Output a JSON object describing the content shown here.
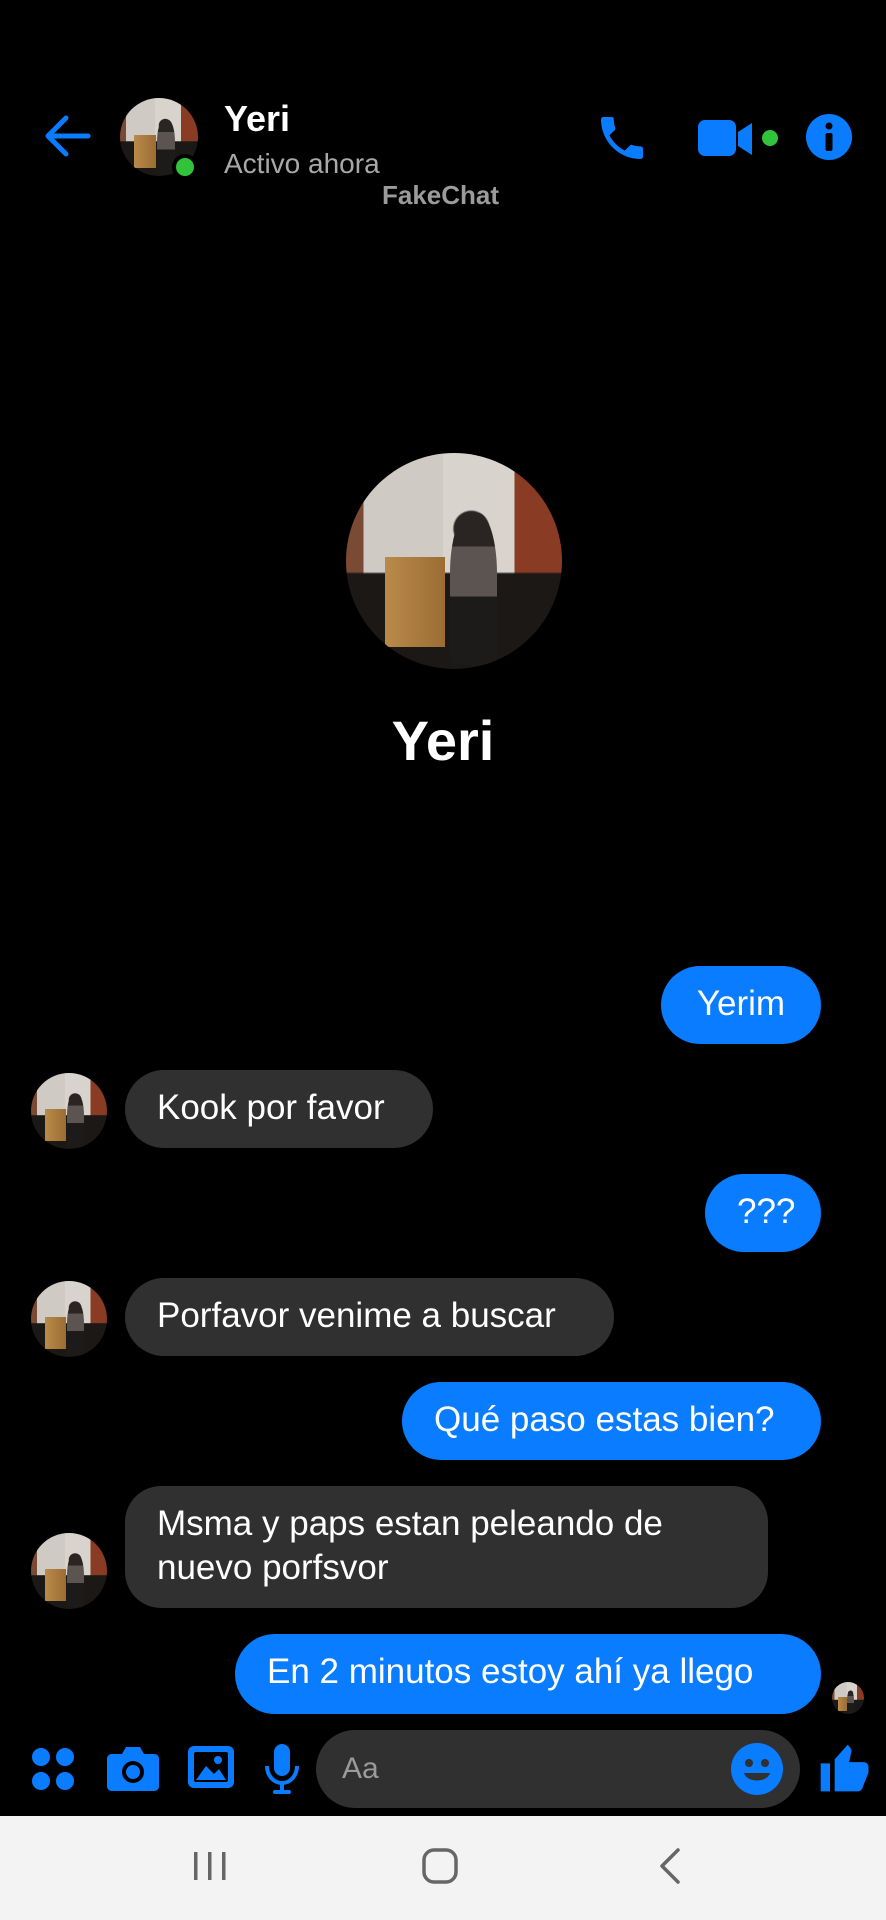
{
  "header": {
    "contact_name": "Yeri",
    "status": "Activo ahora",
    "watermark": "FakeChat"
  },
  "profile": {
    "name": "Yeri"
  },
  "messages": [
    {
      "direction": "outgoing",
      "text": "Yerim"
    },
    {
      "direction": "incoming",
      "text": "Kook por favor"
    },
    {
      "direction": "outgoing",
      "text": "???"
    },
    {
      "direction": "incoming",
      "text": "Porfavor venime a buscar"
    },
    {
      "direction": "outgoing",
      "text": "Qué paso estas bien?"
    },
    {
      "direction": "incoming",
      "lines": [
        "Msma y paps estan peleando de",
        "nuevo porfsvor"
      ]
    },
    {
      "direction": "outgoing",
      "text": "En 2 minutos estoy ahí ya llego"
    }
  ],
  "composer": {
    "placeholder": "Aa"
  },
  "colors": {
    "accent": "#0a7cff",
    "incoming_bubble": "#303030",
    "online": "#31c43b",
    "background": "#000000"
  },
  "icons": [
    "back-arrow-icon",
    "phone-icon",
    "video-camera-icon",
    "info-icon",
    "apps-icon",
    "camera-icon",
    "gallery-icon",
    "microphone-icon",
    "emoji-icon",
    "thumbs-up-icon"
  ]
}
